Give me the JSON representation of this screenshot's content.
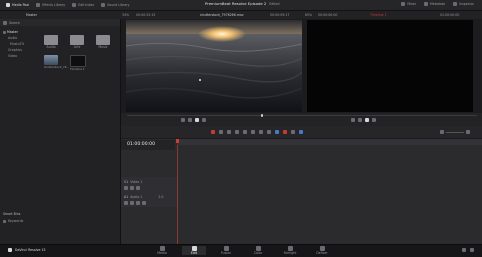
{
  "topbar": {
    "tabs": [
      "Media Pool",
      "Effects Library",
      "Edit Index",
      "Sound Library"
    ],
    "title": "PremiumBeat Resolve Episode 2",
    "edited_label": "Edited",
    "right_items": [
      "Mixer",
      "Metadata",
      "Inspector"
    ]
  },
  "subbar": {
    "master_label": "Master",
    "zoom_label": "34%",
    "source_tc": "00:00:25:15",
    "clip_name": "shutterstock_7976266.mov",
    "source_duration": "00:00:09:17",
    "program_zoom": "65%",
    "program_tc": "00:00:00:00",
    "timeline_name": "Timeline 1",
    "program_tc2": "01:00:00:00"
  },
  "media_pool": {
    "search_placeholder": "Search",
    "tree": [
      "Master",
      "Audio",
      "Music/FX",
      "Graphics",
      "Video"
    ],
    "bins": [
      "Audio",
      "Grfx",
      "Music"
    ],
    "clips": [
      "shutterstock_79...",
      "Timeline 1"
    ],
    "smart_bins_label": "Smart Bins",
    "keywords_label": "Keywords"
  },
  "timeline": {
    "timecode": "01:00:00:00",
    "tracks": [
      {
        "id": "V1",
        "name": "Video 1"
      },
      {
        "id": "A1",
        "name": "Audio 1",
        "level": "2.0"
      }
    ]
  },
  "bottombar": {
    "app_name": "DaVinci Resolve 15",
    "pages": [
      {
        "label": "Media",
        "icon": "media-page-icon"
      },
      {
        "label": "Edit",
        "icon": "edit-page-icon"
      },
      {
        "label": "Fusion",
        "icon": "fusion-page-icon"
      },
      {
        "label": "Color",
        "icon": "color-page-icon"
      },
      {
        "label": "Fairlight",
        "icon": "fairlight-page-icon"
      },
      {
        "label": "Deliver",
        "icon": "deliver-page-icon"
      }
    ],
    "active_page": "Edit"
  },
  "colors": {
    "accent_red": "#c43a34",
    "accent_blue": "#4a78c8",
    "background": "#1c1c1e"
  }
}
